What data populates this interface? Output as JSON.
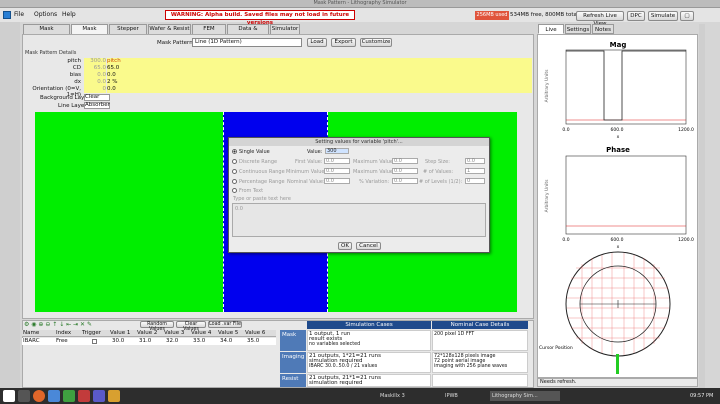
{
  "window": {
    "title": "Mask Pattern - Lithography Simulator"
  },
  "menu": [
    "File",
    "Options",
    "Help"
  ],
  "warning": "WARNING: Alpha build. Saved files may not load in future versions",
  "memory": {
    "used": "256MB used",
    "total": "534MB free, 800MB total"
  },
  "header_buttons": {
    "refresh": "Refresh Live View",
    "dpc": "DPC",
    "simulate": "Simulate"
  },
  "tabs": [
    "Mask Technology",
    "Mask Pattern",
    "Stepper Setup",
    "Wafer & Resist",
    "FEM Control",
    "Data & Results",
    "Simulator"
  ],
  "pattern_bar": {
    "label": "Mask Pattern",
    "value": "Line (1D Pattern)",
    "load": "Load",
    "export": "Export",
    "customize": "Customize"
  },
  "details_label": "Mask Pattern Details",
  "params": [
    {
      "name": "pitch",
      "value": "300.0",
      "extra": "pitch"
    },
    {
      "name": "CD",
      "value": "65.0",
      "extra": "65.0"
    },
    {
      "name": "bias",
      "value": "0.0",
      "extra": "0.0"
    },
    {
      "name": "dx",
      "value": "0.0",
      "extra": "2 %"
    },
    {
      "name": "Orientation (0=V, 1=H)",
      "value": "0",
      "extra": "0.0"
    }
  ],
  "layers": {
    "bg_label": "Background Layer",
    "bg_value": "Clear",
    "line_label": "Line Layer",
    "line_value": "Absorber"
  },
  "dialog": {
    "title": "Setting values for variable 'pitch'...",
    "single": "Single Value",
    "single_value_label": "Value:",
    "single_value": "300",
    "discrete": "Discrete Range",
    "continuous": "Continuous Range",
    "percentage": "Percentage Range",
    "from_text": "From Text",
    "first_label": "First Value:",
    "first_value": "0.0",
    "max_label": "Maximum Value:",
    "max_value": "0.0",
    "step_label": "Step Size:",
    "step_value": "0.0",
    "min_label": "Minimum Value:",
    "min_value": "0.0",
    "nvalues_label": "# of Values:",
    "nvalues_value": "1",
    "nominal_label": "Nominal Value:",
    "nominal_value": "0.0",
    "variation_label": "% Variation:",
    "variation_value": "0.0",
    "levels_label": "# of Levels (1/2):",
    "levels_value": "0",
    "text_prompt": "Type or paste text here",
    "text_value": "0.0",
    "ok": "OK",
    "cancel": "Cancel"
  },
  "toolbar2": {
    "random": "Random Values",
    "clear": "Clear Values",
    "load": "Load .var File"
  },
  "var_table": {
    "headers": [
      "Name",
      "Index",
      "Trigger",
      "Value 1",
      "Value 2",
      "Value 3",
      "Value 4",
      "Value 5",
      "Value 6"
    ],
    "row": [
      "IBARC",
      "Free",
      "",
      "30.0",
      "31.0",
      "32.0",
      "33.0",
      "34.0",
      "35.0"
    ]
  },
  "sim_table": {
    "headers": [
      "Simulation Cases",
      "Nominal Case Details"
    ],
    "rows": [
      {
        "label": "Mask",
        "cases": [
          "1 output, 1 run",
          "result exists",
          "no variables selected"
        ],
        "details": [
          "200 pixel 1D FFT"
        ]
      },
      {
        "label": "Imaging",
        "cases": [
          "21 outputs, 1*21=21 runs",
          "simulation required",
          "IBARC 30.0..50.0 / 21 values"
        ],
        "details": [
          "72*128x128 pixels image",
          "72 point aerial image",
          "imaging with 256 plane waves"
        ]
      },
      {
        "label": "Resist",
        "cases": [
          "21 outputs, 21*1=21 runs",
          "simulation required"
        ],
        "details": [
          ""
        ]
      }
    ]
  },
  "right": {
    "tabs": [
      "Live View",
      "Settings",
      "Notes"
    ],
    "mag_title": "Mag",
    "phase_title": "Phase",
    "ylabel": "Arbitrary Units",
    "xlabel": "x",
    "ticks": [
      "0.0",
      "600.0",
      "1200.0"
    ],
    "cursor_label": "Cursor Position",
    "status": "Needs refresh."
  },
  "taskbar": {
    "clock": "09:57 PM",
    "tasks": [
      "Maskillx 3",
      "IPWB",
      "Lithography Sim..."
    ]
  },
  "colors": {
    "green": "#00ee00",
    "blue": "#0000ee",
    "yellow": "#fafa8c",
    "header": "#1f4a8c",
    "warning": "#cc0000"
  }
}
